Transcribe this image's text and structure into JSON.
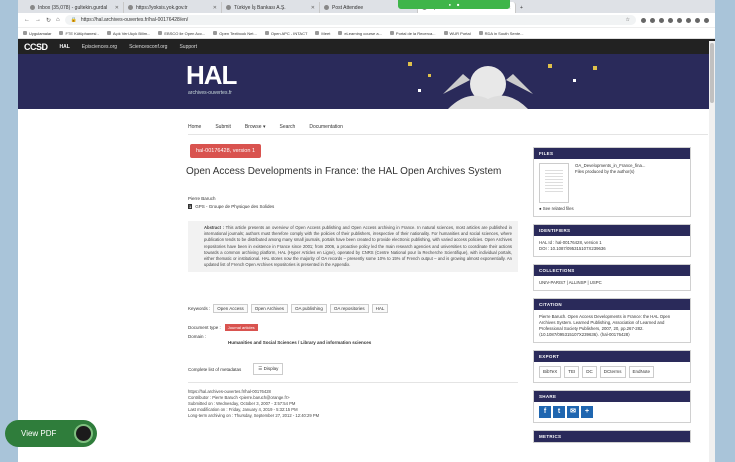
{
  "tabs": [
    {
      "label": "Inbox (35,078) - gultekin.gurdal"
    },
    {
      "label": "https://yoksis.yok.gov.tr"
    },
    {
      "label": "Türkiye İş Bankası A.Ş."
    },
    {
      "label": "Post Attendee"
    },
    {
      "label": "Open Acc"
    }
  ],
  "address": {
    "url": "https://hal.archives-ouvertes.fr/hal-00176428/en/"
  },
  "bookmarks": [
    "Uygulamalar",
    "FTE Kütüphanesi -",
    "Açık Veri Açık Bilim...",
    "EBSCO ile Open Acc...",
    "Open Textbook Net...",
    "Open APC - INTACT",
    "Meet",
    "eLearning course a...",
    "Portal de la Recerca...",
    "WUR Portal",
    "RDA in South Sente..."
  ],
  "ccsd": {
    "logo": "CCSD",
    "items": [
      "HAL",
      "Episciences.org",
      "Sciencesconf.org",
      "Support"
    ]
  },
  "banner": {
    "logo": "HAL",
    "subtitle": "archives-ouvertes.fr"
  },
  "nav": [
    "Home",
    "Submit",
    "Browse ▾",
    "Search",
    "Documentation"
  ],
  "record": {
    "version": "hal-00176428, version 1",
    "title": "Open Access Developments in France: the HAL Open Archives System",
    "author": "Pierre Baruch",
    "lab_num": "1",
    "lab": "GPS - Groupe de Physique des Solides",
    "abstract_label": "Abstract :",
    "abstract": "This article presents an overview of Open Access publishing and Open Access archiving in France. In natural sciences, most articles are published in international journals; authors must therefore comply with the policies of their publishers, irrespective of their nationality. For humanities and social sciences, where publication tends to be distributed among many small journals, portals have been created to provide electronic publishing, with varied access policies. Open Archives repositories have been in existence in France since 2001; from 2006, a proactive policy led the main research agencies and universities to coordinate their actions towards a common archiving platform, HAL (Hyper Articles en Ligne), operated by CNRS (Centre National pour la Recherche Scientifique), with individual portals, either thematic or institutional. HAL stores now the majority of OA records – presently some 10% to 15% of French output – and is growing almost exponentially. An updated list of French Open Archives repositories is presented in the Appendix.",
    "keywords_label": "Keywords :",
    "keywords": [
      "Open Access",
      "Open Archives",
      "OA publishing",
      "OA repositories",
      "HAL"
    ],
    "doctype_label": "Document type :",
    "doctype": "Journal articles",
    "domain_label": "Domain :",
    "domain": "Humanities and Social Sciences / Library and information sciences",
    "metadata_label": "Complete list of metadatas",
    "display_btn": "Display",
    "footer": [
      "https://hal.archives-ouvertes.fr/hal-00176428",
      "Contributor : Pierre Baruch <pierre.baruch@orange.fr>",
      "Submitted on : Wednesday, October 3, 2007 - 3:57:54 PM",
      "Last modification on : Friday, January 4, 2019 - 5:32:15 PM",
      "Long-term archiving on : Thursday, September 27, 2012 - 12:40:29 PM"
    ]
  },
  "sidebar": {
    "files_title": "FILES",
    "file_name": "OA_Developments_in_France_fina...",
    "file_desc": "Files produced by the author(s)",
    "see_related": "See related files",
    "identifiers_title": "IDENTIFIERS",
    "hal_id": "HAL Id : hal-00176428, version 1",
    "doi": "DOI : 10.1087/095315107X239636",
    "collections_title": "COLLECTIONS",
    "collections": "UNIV-PARIS7 | ALLINSP | USPC",
    "citation_title": "CITATION",
    "citation": "Pierre Baruch. Open Access Developments in France: the HAL Open Archives System. Learned Publishing, Association of Learned and Professional Society Publishers, 2007, 20, pp.267-282. ⟨10.1087/095315107X239636⟩. ⟨hal-00176428⟩",
    "export_title": "EXPORT",
    "export": [
      "BibTeX",
      "TEI",
      "DC",
      "DCterms",
      "EndNote"
    ],
    "share_title": "SHARE",
    "metrics_title": "METRICS"
  },
  "viewpdf": "View PDF",
  "colors": {
    "hal_navy": "#2a2a5a",
    "accent_red": "#d9534f",
    "viewpdf_green": "#2f7d3b"
  }
}
